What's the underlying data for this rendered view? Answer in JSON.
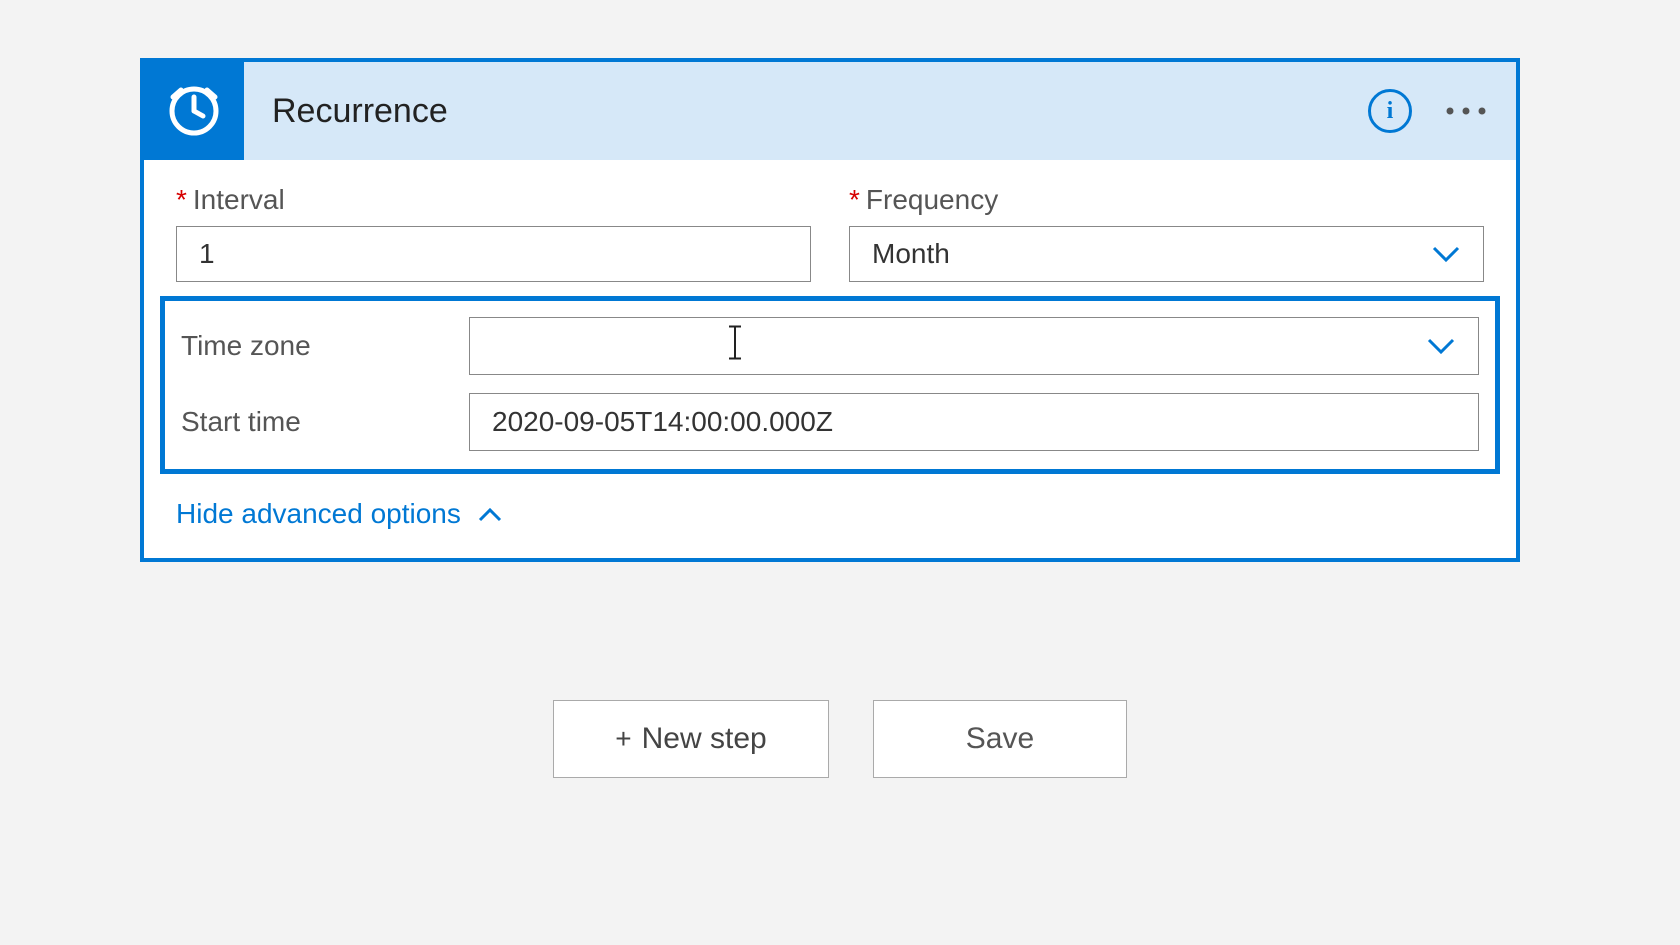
{
  "card": {
    "title": "Recurrence",
    "fields": {
      "interval": {
        "label": "Interval",
        "required": true,
        "value": "1"
      },
      "frequency": {
        "label": "Frequency",
        "required": true,
        "value": "Month"
      },
      "timezone": {
        "label": "Time zone",
        "value": ""
      },
      "starttime": {
        "label": "Start time",
        "value": "2020-09-05T14:00:00.000Z"
      }
    },
    "toggle": "Hide advanced options"
  },
  "actions": {
    "new_step": "New step",
    "save": "Save"
  }
}
